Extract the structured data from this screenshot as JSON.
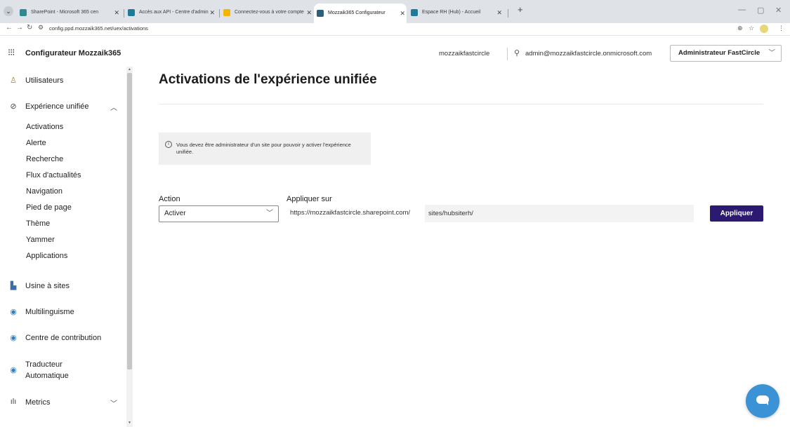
{
  "browser": {
    "tabs": [
      {
        "title": "SharePoint - Microsoft 365 cen",
        "active": false,
        "icon_color": "#2f8a8f"
      },
      {
        "title": "Accès aux API - Centre d'admin",
        "active": false,
        "icon_color": "#1f7a9a"
      },
      {
        "title": "Connectez-vous à votre compte",
        "active": false,
        "icon_color": "#f4b400"
      },
      {
        "title": "Mozzaik365 Configurateur",
        "active": true,
        "icon_color": "#2c5f7a"
      },
      {
        "title": "Espace RH (Hub) - Accueil",
        "active": false,
        "icon_color": "#1f7a9a"
      }
    ],
    "new_tab": "+",
    "url": "config.ppd.mozzaik365.net/uex/activations"
  },
  "app": {
    "title": "Configurateur Mozzaik365",
    "tenant": "mozzaikfastcircle",
    "user_email": "admin@mozzaikfastcircle.onmicrosoft.com",
    "admin_label": "Administrateur FastCircle"
  },
  "sidebar": {
    "items": [
      {
        "label": "Utilisateurs",
        "icon": "users-icon"
      },
      {
        "label": "Expérience unifiée",
        "icon": "compass-icon"
      },
      {
        "label": "Usine à sites",
        "icon": "site-factory-icon"
      },
      {
        "label": "Multilinguisme",
        "icon": "globe-icon"
      },
      {
        "label": "Centre de contribution",
        "icon": "globe-icon"
      },
      {
        "label": "Traducteur Automatique",
        "label_line1": "Traducteur",
        "label_line2": "Automatique",
        "icon": "globe-icon"
      },
      {
        "label": "Metrics",
        "icon": "bar-chart-icon"
      }
    ],
    "subitems": [
      "Activations",
      "Alerte",
      "Recherche",
      "Flux d'actualités",
      "Navigation",
      "Pied de page",
      "Thème",
      "Yammer",
      "Applications"
    ]
  },
  "main": {
    "title": "Activations de l'expérience unifiée",
    "info_text": "Vous devez être administrateur d'un site pour pouvoir y activer l'expérience unifiée.",
    "action_label": "Action",
    "action_value": "Activer",
    "apply_on_label": "Appliquer sur",
    "site_prefix": "https://mozzaikfastcircle.sharepoint.com/",
    "site_path": "sites/hubsiterh/",
    "apply_button": "Appliquer"
  },
  "colors": {
    "accent": "#2c1a72",
    "chat_fab": "#3b93d6"
  }
}
